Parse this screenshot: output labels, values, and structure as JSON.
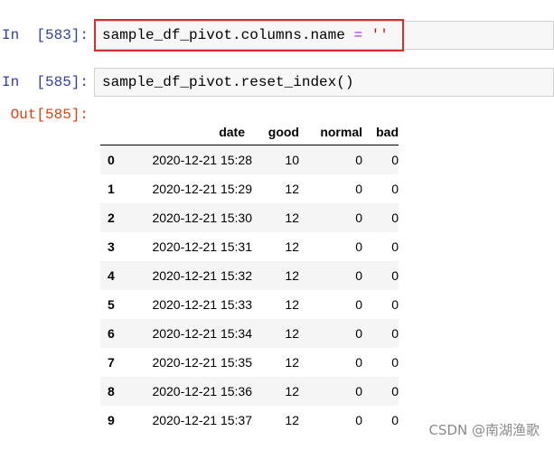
{
  "cells": [
    {
      "prompt": "In  [583]:",
      "code_prefix": "sample_df_pivot.columns.name ",
      "code_op": "=",
      "code_str": " ''"
    },
    {
      "prompt": "In  [585]:",
      "code": "sample_df_pivot.reset_index()"
    }
  ],
  "output": {
    "prompt": "Out[585]:",
    "table": {
      "columns": [
        "date",
        "good",
        "normal",
        "bad"
      ],
      "rows": [
        {
          "index": "0",
          "date": "2020-12-21 15:28",
          "good": "10",
          "normal": "0",
          "bad": "0"
        },
        {
          "index": "1",
          "date": "2020-12-21 15:29",
          "good": "12",
          "normal": "0",
          "bad": "0"
        },
        {
          "index": "2",
          "date": "2020-12-21 15:30",
          "good": "12",
          "normal": "0",
          "bad": "0"
        },
        {
          "index": "3",
          "date": "2020-12-21 15:31",
          "good": "12",
          "normal": "0",
          "bad": "0"
        },
        {
          "index": "4",
          "date": "2020-12-21 15:32",
          "good": "12",
          "normal": "0",
          "bad": "0"
        },
        {
          "index": "5",
          "date": "2020-12-21 15:33",
          "good": "12",
          "normal": "0",
          "bad": "0"
        },
        {
          "index": "6",
          "date": "2020-12-21 15:34",
          "good": "12",
          "normal": "0",
          "bad": "0"
        },
        {
          "index": "7",
          "date": "2020-12-21 15:35",
          "good": "12",
          "normal": "0",
          "bad": "0"
        },
        {
          "index": "8",
          "date": "2020-12-21 15:36",
          "good": "12",
          "normal": "0",
          "bad": "0"
        },
        {
          "index": "9",
          "date": "2020-12-21 15:37",
          "good": "12",
          "normal": "0",
          "bad": "0"
        }
      ]
    }
  },
  "watermark": "CSDN @南湖渔歌",
  "colors": {
    "highlight_border": "#d32f2f",
    "prompt_in": "#303f9f",
    "prompt_out": "#d84315"
  }
}
